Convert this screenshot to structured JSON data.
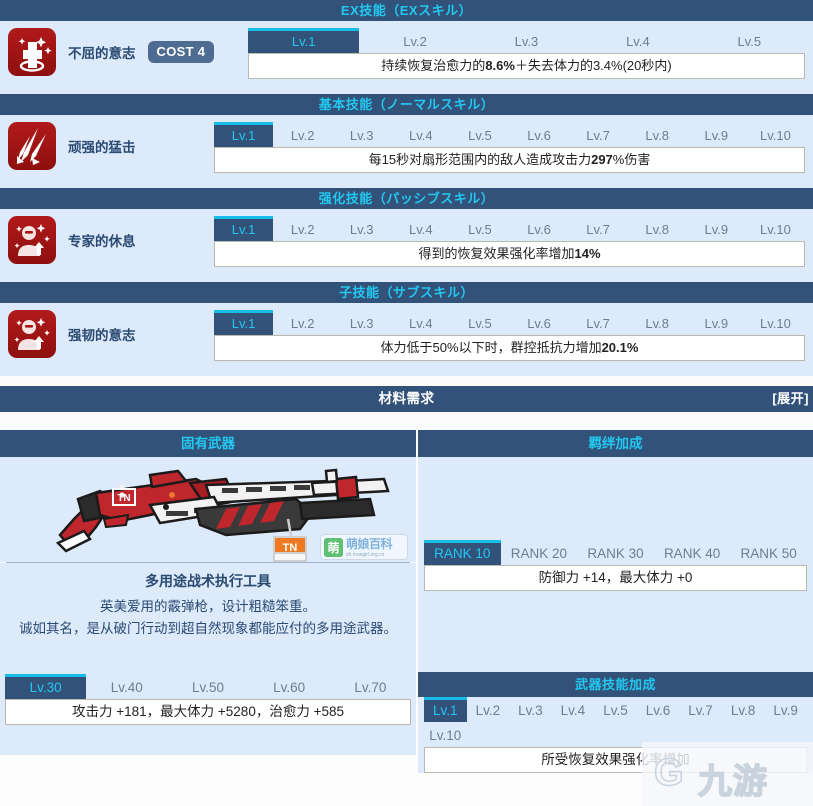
{
  "sections": [
    {
      "header": "EX技能（EXスキル）",
      "icon": "ex-heal-cross-icon",
      "skill_name": "不屈的意志",
      "cost": "COST 4",
      "levels": [
        "Lv.1",
        "Lv.2",
        "Lv.3",
        "Lv.4",
        "Lv.5"
      ],
      "active_level": 0,
      "description": "持续恢复治愈力的8.6%＋失去体力的3.4%(20秒内)"
    },
    {
      "header": "基本技能（ノーマルスキル）",
      "icon": "normal-slash-icon",
      "skill_name": "顽强的猛击",
      "cost": "",
      "levels": [
        "Lv.1",
        "Lv.2",
        "Lv.3",
        "Lv.4",
        "Lv.5",
        "Lv.6",
        "Lv.7",
        "Lv.8",
        "Lv.9",
        "Lv.10"
      ],
      "active_level": 0,
      "description": "每15秒对扇形范围内的敌人造成攻击力297%伤害"
    },
    {
      "header": "强化技能（パッシブスキル）",
      "icon": "passive-buff-icon",
      "skill_name": "专家的休息",
      "cost": "",
      "levels": [
        "Lv.1",
        "Lv.2",
        "Lv.3",
        "Lv.4",
        "Lv.5",
        "Lv.6",
        "Lv.7",
        "Lv.8",
        "Lv.9",
        "Lv.10"
      ],
      "active_level": 0,
      "description": "得到的恢复效果强化率增加14%"
    },
    {
      "header": "子技能（サブスキル）",
      "icon": "subskill-buff-icon",
      "skill_name": "强韧的意志",
      "cost": "",
      "levels": [
        "Lv.1",
        "Lv.2",
        "Lv.3",
        "Lv.4",
        "Lv.5",
        "Lv.6",
        "Lv.7",
        "Lv.8",
        "Lv.9",
        "Lv.10"
      ],
      "active_level": 0,
      "description": "体力低于50%以下时，群控抵抗力增加20.1%"
    }
  ],
  "materials": {
    "title": "材料需求",
    "toggle": "[展开]"
  },
  "weapon": {
    "col_title": "固有武器",
    "image_name": "red-shotgun-illustration",
    "name": "多用途战术执行工具",
    "desc_line1": "英美爱用的霰弹枪，设计粗糙笨重。",
    "desc_line2": "诚如其名，是从破门行动到超自然现象都能应付的多用途武器。",
    "levels": [
      "Lv.30",
      "Lv.40",
      "Lv.50",
      "Lv.60",
      "Lv.70"
    ],
    "active_level": 0,
    "stats": "攻击力 +181，最大体力 +5280，治愈力 +585"
  },
  "bond": {
    "col_title": "羁绊加成",
    "ranks": [
      "RANK 10",
      "RANK 20",
      "RANK 30",
      "RANK 40",
      "RANK 50"
    ],
    "active_rank": 0,
    "effect": "防御力 +14，最大体力 +0"
  },
  "weapon_skill": {
    "header": "武器技能加成",
    "levels": [
      "Lv.1",
      "Lv.2",
      "Lv.3",
      "Lv.4",
      "Lv.5",
      "Lv.6",
      "Lv.7",
      "Lv.8",
      "Lv.9",
      "Lv.10"
    ],
    "active_level": 0,
    "description": "所受恢复效果强化率增加"
  },
  "watermarks": {
    "moegirl_badge": "萌",
    "moegirl_name": "萌娘百科",
    "moegirl_url": "zh.moegirl.org.cn",
    "ninegame_g": "G",
    "ninegame_cn": "九游"
  },
  "colors": {
    "bar": "#33527a",
    "accent_cyan": "#22c8f0",
    "panel": "#ddeafa",
    "icon_red": "#a81515"
  }
}
